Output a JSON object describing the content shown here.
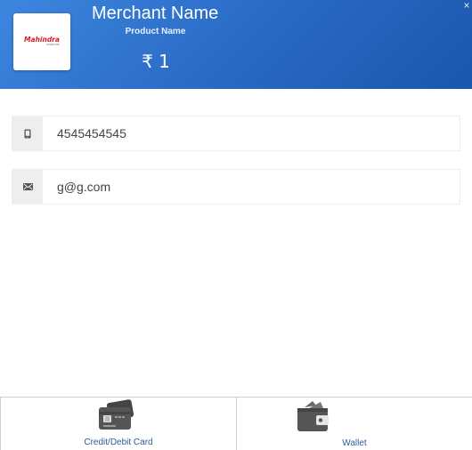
{
  "header": {
    "merchant_name": "Merchant Name",
    "product_name": "Product Name",
    "amount": "₹ 1",
    "logo_text": "Mahindra",
    "logo_subtext": "COMVIVA",
    "close_glyph": "×"
  },
  "form": {
    "phone": {
      "value": "4545454545",
      "icon": "mobile-phone-icon"
    },
    "email": {
      "value": "g@g.com",
      "icon": "envelope-icon"
    }
  },
  "tabs": [
    {
      "label": "Credit/Debit Card",
      "icon": "credit-card-icon"
    },
    {
      "label": "Wallet",
      "icon": "wallet-icon"
    }
  ],
  "colors": {
    "header_start": "#3d86df",
    "header_end": "#1a56ad",
    "logo_red": "#d71920",
    "tab_text": "#2f5d93",
    "icon_gray": "#555555"
  }
}
